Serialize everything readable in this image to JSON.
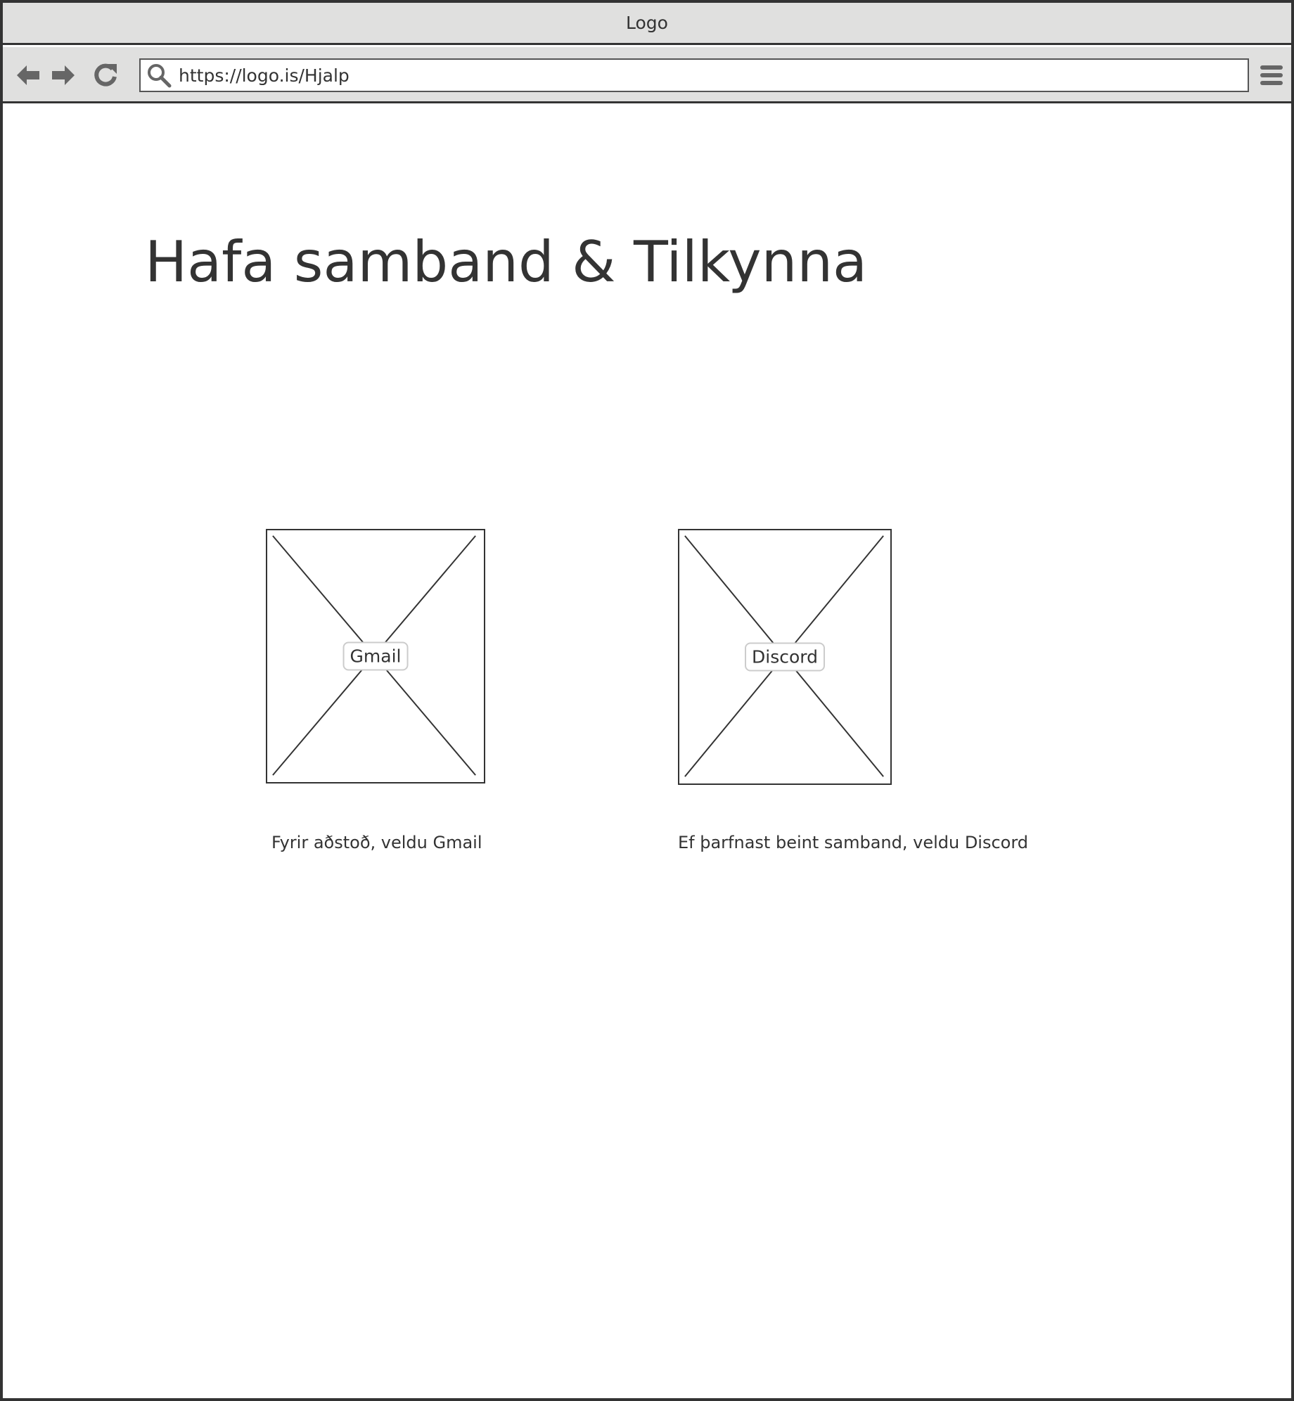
{
  "window": {
    "title": "Logo"
  },
  "toolbar": {
    "url": "https://logo.is/Hjalp",
    "icons": [
      "arrow-left-icon",
      "arrow-right-icon",
      "reload-icon",
      "search-icon",
      "hamburger-menu-icon"
    ]
  },
  "main": {
    "title": "Hafa samband & Tilkynna",
    "cards": [
      {
        "label": "Gmail",
        "caption": "Fyrir aðstoð, veldu Gmail"
      },
      {
        "label": "Discord",
        "caption": "Ef þarfnast beint samband, veldu Discord"
      }
    ]
  },
  "colors": {
    "chrome": "#e0e0df",
    "stroke": "#333333",
    "icon": "#666666",
    "background": "#ffffff"
  }
}
